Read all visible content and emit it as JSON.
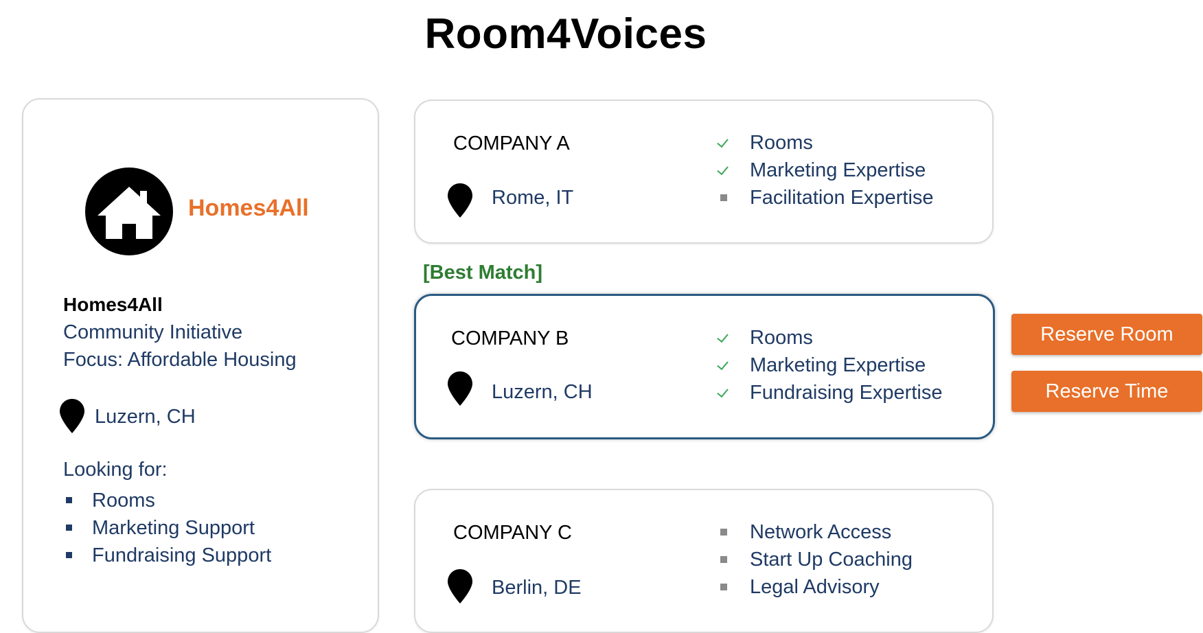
{
  "app": {
    "title": "Room4Voices"
  },
  "profile": {
    "logo_text": "Homes4All",
    "name": "Homes4All",
    "type": "Community Initiative",
    "focus": "Focus: Affordable Housing",
    "location": "Luzern, CH",
    "looking_for_label": "Looking for:",
    "looking_for": [
      "Rooms",
      "Marketing Support",
      "Fundraising Support"
    ]
  },
  "best_match_label": "[Best Match]",
  "companies": [
    {
      "name": "COMPANY A",
      "location": "Rome, IT",
      "features": [
        {
          "label": "Rooms",
          "icon": "check-icon"
        },
        {
          "label": "Marketing Expertise",
          "icon": "check-icon"
        },
        {
          "label": "Facilitation Expertise",
          "icon": "square-bullet-icon"
        }
      ]
    },
    {
      "name": "COMPANY B",
      "location": "Luzern, CH",
      "features": [
        {
          "label": "Rooms",
          "icon": "check-icon"
        },
        {
          "label": "Marketing Expertise",
          "icon": "check-icon"
        },
        {
          "label": "Fundraising Expertise",
          "icon": "check-icon"
        }
      ]
    },
    {
      "name": "COMPANY C",
      "location": "Berlin, DE",
      "features": [
        {
          "label": "Network Access",
          "icon": "square-bullet-icon"
        },
        {
          "label": "Start Up Coaching",
          "icon": "square-bullet-icon"
        },
        {
          "label": "Legal Advisory",
          "icon": "square-bullet-icon"
        }
      ]
    }
  ],
  "actions": {
    "reserve_room": "Reserve Room",
    "reserve_time": "Reserve Time"
  },
  "colors": {
    "accent": "#e8702a",
    "best_match": "#2e7d32",
    "best_border": "#2a5a82",
    "check": "#3aa655",
    "text": "#1f3a64"
  }
}
